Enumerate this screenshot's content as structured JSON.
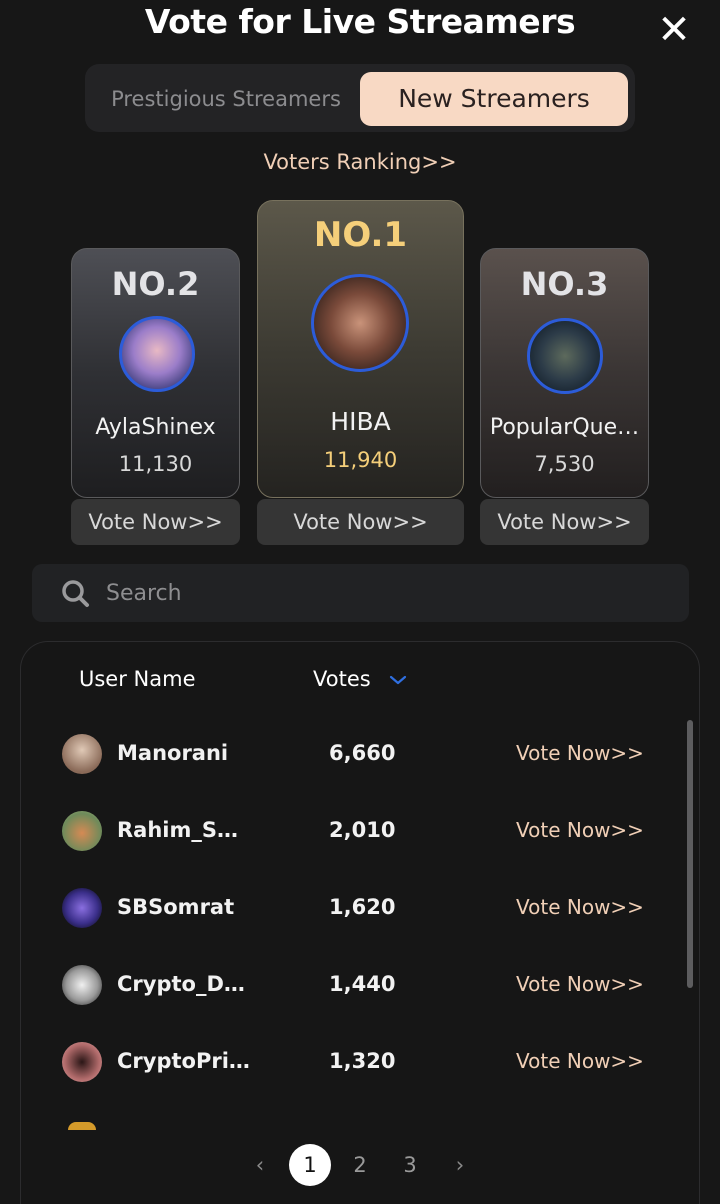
{
  "header": {
    "title": "Vote for Live Streamers",
    "close_icon": "close-icon"
  },
  "tabs": [
    {
      "label": "Prestigious Streamers",
      "active": false
    },
    {
      "label": "New Streamers",
      "active": true
    }
  ],
  "voters_ranking_label": "Voters Ranking>>",
  "podium": {
    "first": {
      "rank": "NO.1",
      "name": "HIBA",
      "votes": "11,940",
      "vote_label": "Vote Now>>"
    },
    "second": {
      "rank": "NO.2",
      "name": "AylaShinex",
      "votes": "11,130",
      "vote_label": "Vote Now>>"
    },
    "third": {
      "rank": "NO.3",
      "name": "PopularQue…",
      "votes": "7,530",
      "vote_label": "Vote Now>>"
    }
  },
  "search": {
    "placeholder": "Search",
    "value": ""
  },
  "table": {
    "columns": {
      "user": "User Name",
      "votes": "Votes"
    },
    "rows": [
      {
        "name": "Manorani",
        "votes": "6,660",
        "action": "Vote Now>>"
      },
      {
        "name": "Rahim_S…",
        "votes": "2,010",
        "action": "Vote Now>>"
      },
      {
        "name": "SBSomrat",
        "votes": "1,620",
        "action": "Vote Now>>"
      },
      {
        "name": "Crypto_D…",
        "votes": "1,440",
        "action": "Vote Now>>"
      },
      {
        "name": "CryptoPri…",
        "votes": "1,320",
        "action": "Vote Now>>"
      }
    ]
  },
  "pagination": {
    "prev": "‹",
    "pages": [
      "1",
      "2",
      "3"
    ],
    "current": "1",
    "next": "›"
  },
  "colors": {
    "accent": "#f8d9c4",
    "gold": "#f5cf7a",
    "avatar_ring": "#2c5cd9",
    "sort_arrow": "#2f6fe0"
  }
}
